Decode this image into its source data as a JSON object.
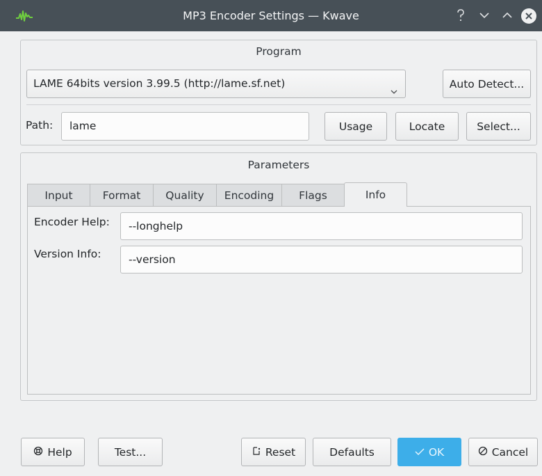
{
  "window": {
    "title": "MP3 Encoder Settings — Kwave",
    "controls": [
      "help-icon",
      "minimize-icon",
      "maximize-icon",
      "close-icon"
    ],
    "accent": "#3daee9"
  },
  "program": {
    "group_title": "Program",
    "selected_program": "LAME 64bits version 3.99.5 (http://lame.sf.net)",
    "auto_detect_label": "Auto Detect...",
    "path_label": "Path:",
    "path_value": "lame",
    "usage_label": "Usage",
    "locate_label": "Locate",
    "select_label": "Select..."
  },
  "parameters": {
    "group_title": "Parameters",
    "tabs": [
      {
        "label": "Input"
      },
      {
        "label": "Format"
      },
      {
        "label": "Quality"
      },
      {
        "label": "Encoding"
      },
      {
        "label": "Flags"
      },
      {
        "label": "Info"
      }
    ],
    "active_tab": "Info",
    "info": {
      "encoder_help_label": "Encoder Help:",
      "encoder_help_value": "--longhelp",
      "version_info_label": "Version Info:",
      "version_info_value": "--version"
    }
  },
  "buttons": {
    "help": "Help",
    "test": "Test...",
    "reset": "Reset",
    "defaults": "Defaults",
    "ok": "OK",
    "cancel": "Cancel"
  }
}
